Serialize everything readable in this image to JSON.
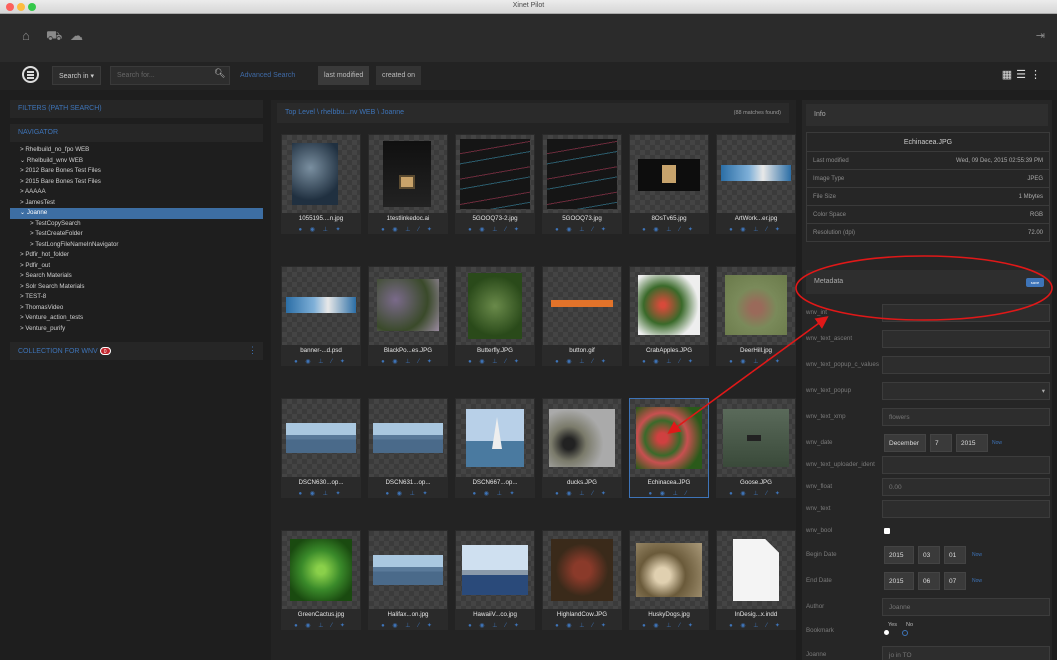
{
  "window": {
    "title": "Xinet Pilot"
  },
  "search": {
    "scope_label": "Search in ▾",
    "placeholder": "Search for...",
    "advanced_label": "Advanced Search",
    "sort_modified": "last modified",
    "sort_created": "created on"
  },
  "sidebar": {
    "filters_label": "FILTERS (PATH SEARCH)",
    "navigator_label": "NAVIGATOR",
    "items": [
      {
        "label": "> Rhelbuild_no_fpo WEB",
        "indent": 0
      },
      {
        "label": "⌄ Rhelbuild_wnv WEB",
        "indent": 0
      },
      {
        "label": "> 2012 Bare Bones Test Files",
        "indent": 0
      },
      {
        "label": "> 2015 Bare Bones Test Files",
        "indent": 0
      },
      {
        "label": "> AAAAA",
        "indent": 0
      },
      {
        "label": "> JamesTest",
        "indent": 0
      },
      {
        "label": "⌄ Joanne",
        "indent": 0,
        "selected": true
      },
      {
        "label": "> TestCopySearch",
        "indent": 1
      },
      {
        "label": "> TestCreateFolder",
        "indent": 1
      },
      {
        "label": "> TestLongFileNameInNavigator",
        "indent": 1
      },
      {
        "label": "> Pdfir_hot_folder",
        "indent": 0
      },
      {
        "label": "> Pdfir_out",
        "indent": 0
      },
      {
        "label": "> Search Materials",
        "indent": 0
      },
      {
        "label": "> Solr Search Materials",
        "indent": 0
      },
      {
        "label": "> TEST-8",
        "indent": 0
      },
      {
        "label": "> ThomasVideo",
        "indent": 0
      },
      {
        "label": "> Venture_action_tests",
        "indent": 0
      },
      {
        "label": "> Venture_purify",
        "indent": 0
      }
    ],
    "collection_label": "COLLECTION FOR WNV",
    "collection_count": "0"
  },
  "breadcrumb": {
    "path": "Top Level \\  rhelbbu...nv WEB \\  Joanne",
    "matches": "(88 matches found)"
  },
  "assets": [
    {
      "name": "1055195....n.jpg",
      "kind": "photo-dark",
      "actions": "● ◉ ⊥ ✦"
    },
    {
      "name": "1testlinkedoc.ai",
      "kind": "poster",
      "actions": "● ◉ ⊥ ⁄ ✦"
    },
    {
      "name": "5GOOQ73-2.jpg",
      "kind": "dark-lines",
      "actions": "● ◉ ⊥ ⁄ ✦"
    },
    {
      "name": "5GOOQ73.jpg",
      "kind": "dark-lines",
      "actions": "● ◉ ⊥ ⁄ ✦"
    },
    {
      "name": "8OsTv65.jpg",
      "kind": "card",
      "actions": "● ◉ ⊥ ⁄ ✦"
    },
    {
      "name": "ArtWork...er.jpg",
      "kind": "banner",
      "actions": "● ◉ ⊥ ⁄ ✦"
    },
    {
      "name": "banner-...d.psd",
      "kind": "banner",
      "actions": "● ◉ ⊥ ⁄ ✦"
    },
    {
      "name": "BlackPo...es.JPG",
      "kind": "leaves",
      "actions": "● ◉ ⊥ ⁄ ✦"
    },
    {
      "name": "Butterfly.JPG",
      "kind": "green",
      "actions": "● ◉ ⊥ ⁄ ✦"
    },
    {
      "name": "button.gif",
      "kind": "button",
      "actions": "● ◉ ⊥ ⁄ ✦"
    },
    {
      "name": "CrabApples.JPG",
      "kind": "tree",
      "actions": "● ◉ ⊥ ⁄ ✦"
    },
    {
      "name": "DeerHill.jpg",
      "kind": "deer",
      "actions": "● ◉ ⊥ ⁄ ✦"
    },
    {
      "name": "DSCN630...op...",
      "kind": "sea",
      "actions": "● ◉ ⊥ ✦"
    },
    {
      "name": "DSCN631...op...",
      "kind": "sea",
      "actions": "● ◉ ⊥ ✦"
    },
    {
      "name": "DSCN667...op...",
      "kind": "sail",
      "actions": "● ◉ ⊥ ✦"
    },
    {
      "name": "ducks.JPG",
      "kind": "ducks",
      "actions": "● ◉ ⊥ ⁄ ✦"
    },
    {
      "name": "Echinacea.JPG",
      "kind": "flowers",
      "actions": "● ◉ ⊥ ⁄",
      "selected": true
    },
    {
      "name": "Goose.JPG",
      "kind": "goose",
      "actions": "● ◉ ⊥ ⁄ ✦"
    },
    {
      "name": "GreenCactus.jpg",
      "kind": "cactus",
      "actions": "● ◉ ⊥ ⁄ ✦"
    },
    {
      "name": "Halifax...on.jpg",
      "kind": "sea",
      "actions": "● ◉ ⊥ ⁄ ✦"
    },
    {
      "name": "HawaiiV...co.jpg",
      "kind": "mountain",
      "actions": "● ◉ ⊥ ⁄ ✦"
    },
    {
      "name": "HighlandCow.JPG",
      "kind": "cow",
      "actions": "● ◉ ⊥ ⁄ ✦"
    },
    {
      "name": "HuskyDogs.jpg",
      "kind": "dogs",
      "actions": "● ◉ ⊥ ⁄ ✦"
    },
    {
      "name": "InDesig...x.indd",
      "kind": "doc",
      "actions": "● ◉ ⊥ ⁄ ✦"
    }
  ],
  "info": {
    "panel_title": "Info",
    "file_name": "Echinacea.JPG",
    "rows": [
      {
        "label": "Last modified",
        "value": "Wed, 09 Dec, 2015 02:55:39 PM"
      },
      {
        "label": "Image Type",
        "value": "JPEG"
      },
      {
        "label": "File Size",
        "value": "1 Mbytes"
      },
      {
        "label": "Color Space",
        "value": "RGB"
      },
      {
        "label": "Resolution (dpi)",
        "value": "72.00"
      }
    ]
  },
  "metadata": {
    "panel_title": "Metadata",
    "save_label": "save",
    "fields": [
      {
        "label": "wnv_int",
        "value": ""
      },
      {
        "label": "wnv_text_ascent",
        "value": ""
      },
      {
        "label": "wnv_text_popup_c_values",
        "value": ""
      },
      {
        "label": "wnv_text_popup",
        "value": ""
      },
      {
        "label": "wnv_text_xmp",
        "value": "flowers"
      },
      {
        "label": "wnv_date",
        "value": ""
      },
      {
        "label": "wnv_text_uploader_ident",
        "value": ""
      },
      {
        "label": "wnv_float",
        "value": "0.00"
      },
      {
        "label": "wnv_text",
        "value": ""
      },
      {
        "label": "wnv_bool",
        "value": ""
      },
      {
        "label": "Begin Date",
        "value": ""
      },
      {
        "label": "End Date",
        "value": ""
      },
      {
        "label": "Author",
        "value": "Joanne"
      },
      {
        "label": "Bookmark",
        "value": ""
      },
      {
        "label": "Joanne",
        "value": "jo in TO"
      }
    ],
    "date_month": "December",
    "date_day": "7",
    "date_year": "2015",
    "begin_year": "2015",
    "begin_month": "03",
    "begin_day": "01",
    "end_year": "2015",
    "end_month": "06",
    "end_day": "07",
    "now_label": "Now",
    "bookmark_yes": "Yes",
    "bookmark_no": "No"
  },
  "colors": {
    "accent": "#3e74b8",
    "annotation": "#e01818",
    "selected_nav": "#3d6ea3"
  }
}
